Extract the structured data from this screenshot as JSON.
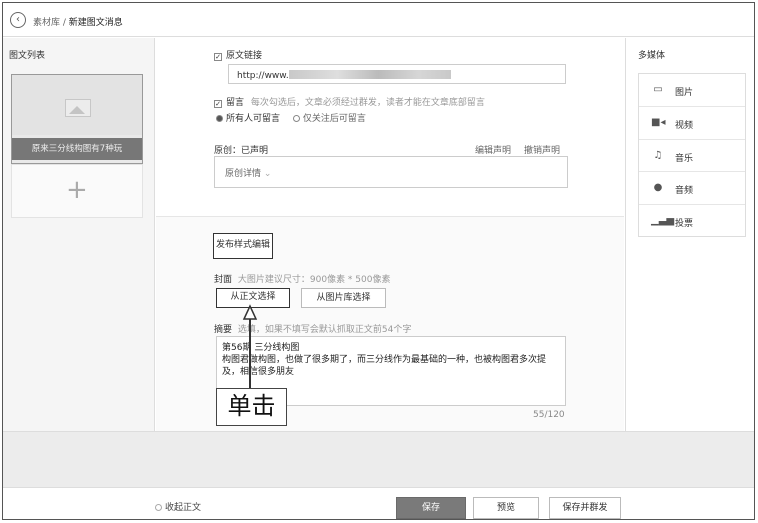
{
  "header": {
    "back_glyph": "‹",
    "breadcrumb_parent": "素材库",
    "separator": " / ",
    "breadcrumb_current": "新建图文消息"
  },
  "left": {
    "title": "图文列表",
    "article_caption": "原来三分线构图有7种玩",
    "add_glyph": "+"
  },
  "main": {
    "source_link_label": "原文链接",
    "source_link_prefix": "http://www.",
    "comment_label": "留言",
    "comment_hint": "每次勾选后，文章必须经过群发，读者才能在文章底部留言",
    "comment_options": [
      "所有人可留言",
      "仅关注后可留言"
    ],
    "original_label": "原创：已声明",
    "edit_claim": "编辑声明",
    "revoke_claim": "撤销声明",
    "original_detail": "原创详情",
    "publish_style_button": "发布样式编辑",
    "cover_label": "封面",
    "cover_hint": "大图片建议尺寸：900像素 * 500像素",
    "from_body_button": "从正文选择",
    "from_library_button": "从图片库选择",
    "summary_label": "摘要",
    "summary_hint": "选填，如果不填写会默认抓取正文前54个字",
    "summary_line1": "第56期 三分线构图",
    "summary_line2": "构图君做构图，也做了很多期了，而三分线作为最基础的一种，也被构图君多次提",
    "summary_line3": "及，相信很多朋友",
    "char_count": "55/120"
  },
  "right": {
    "title": "多媒体",
    "items": [
      {
        "label": "图片",
        "icon": "image-icon"
      },
      {
        "label": "视频",
        "icon": "video-icon"
      },
      {
        "label": "音乐",
        "icon": "music-icon"
      },
      {
        "label": "音频",
        "icon": "audio-icon"
      },
      {
        "label": "投票",
        "icon": "vote-icon"
      }
    ]
  },
  "footer": {
    "collapse_label": "收起正文",
    "save": "保存",
    "preview": "预览",
    "save_send": "保存并群发"
  },
  "annotation": {
    "callout_text": "单击"
  },
  "colors": {
    "primary_button": "#7a7a7a",
    "grey_band": "#ececec"
  }
}
